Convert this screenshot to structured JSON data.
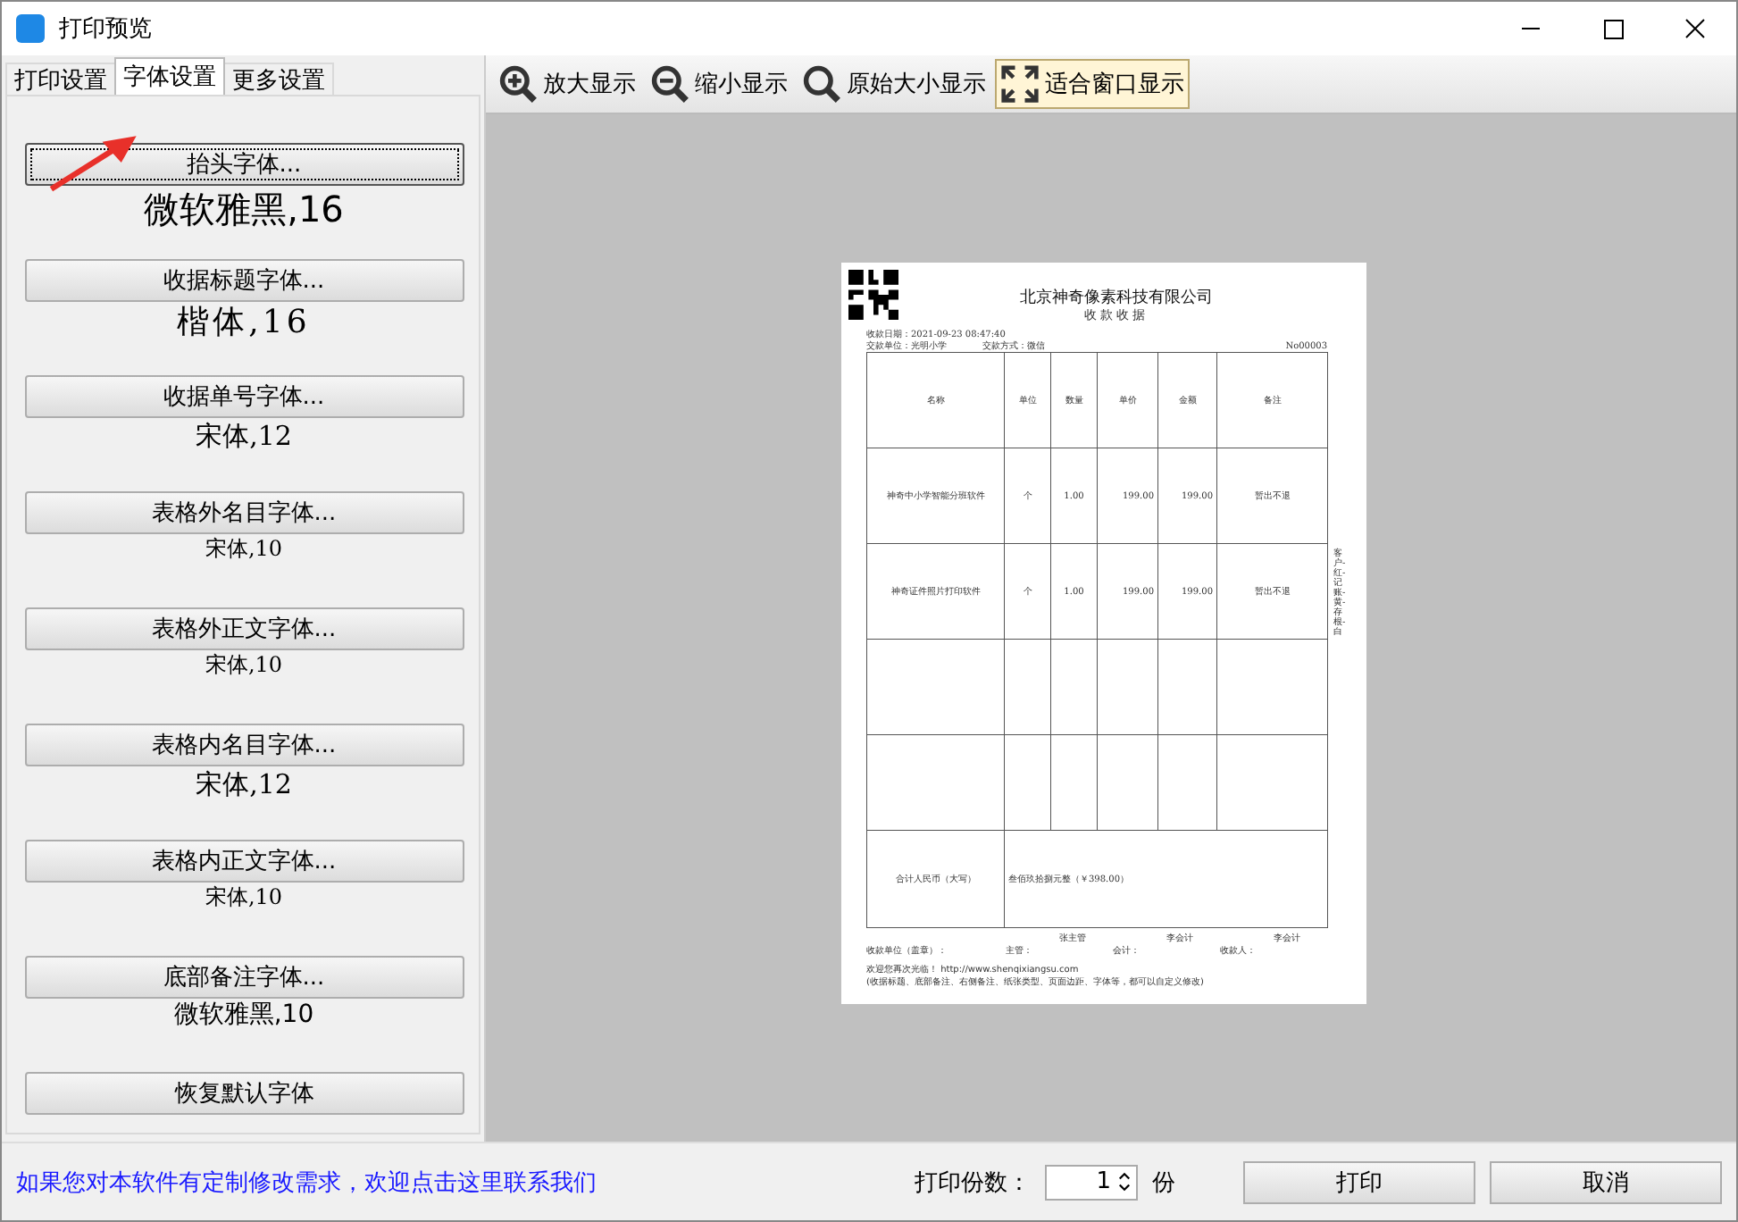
{
  "window": {
    "title": "打印预览"
  },
  "tabs": [
    {
      "label": "打印设置",
      "selected": false
    },
    {
      "label": "字体设置",
      "selected": true
    },
    {
      "label": "更多设置",
      "selected": false
    }
  ],
  "font_settings": [
    {
      "button": "抬头字体...",
      "sample": "微软雅黑,16",
      "kind": "yahei-large",
      "focused": true
    },
    {
      "button": "收据标题字体...",
      "sample": "楷体,16",
      "kind": "kai-large",
      "focused": false
    },
    {
      "button": "收据单号字体...",
      "sample": "宋体,12",
      "kind": "song-medium",
      "focused": false
    },
    {
      "button": "表格外名目字体...",
      "sample": "宋体,10",
      "kind": "song-small",
      "focused": false
    },
    {
      "button": "表格外正文字体...",
      "sample": "宋体,10",
      "kind": "song-small",
      "focused": false
    },
    {
      "button": "表格内名目字体...",
      "sample": "宋体,12",
      "kind": "song-medium",
      "focused": false
    },
    {
      "button": "表格内正文字体...",
      "sample": "宋体,10",
      "kind": "song-small",
      "focused": false
    },
    {
      "button": "底部备注字体...",
      "sample": "微软雅黑,10",
      "kind": "yahei-small",
      "focused": false
    }
  ],
  "restore_button": "恢复默认字体",
  "toolbar": [
    {
      "label": "放大显示",
      "kind": "zoom-in",
      "selected": false
    },
    {
      "label": "缩小显示",
      "kind": "zoom-out",
      "selected": false
    },
    {
      "label": "原始大小显示",
      "kind": "actual",
      "selected": false
    },
    {
      "label": "适合窗口显示",
      "kind": "fit",
      "selected": true
    }
  ],
  "receipt": {
    "company": "北京神奇像素科技有限公司",
    "title": "收款收据",
    "date": "收款日期：2021-09-23 08:47:40",
    "payer": "交款单位：光明小学",
    "method": "交款方式：微信",
    "number": "No00003",
    "columns": [
      "名称",
      "单位",
      "数量",
      "单价",
      "金额",
      "备注"
    ],
    "rows": [
      [
        "神奇中小学智能分班软件",
        "个",
        "1.00",
        "199.00",
        "199.00",
        "暂出不退"
      ],
      [
        "神奇证件照片打印软件",
        "个",
        "1.00",
        "199.00",
        "199.00",
        "暂出不退"
      ],
      [
        "",
        "",
        "",
        "",
        "",
        ""
      ],
      [
        "",
        "",
        "",
        "",
        "",
        ""
      ]
    ],
    "total_label": "合计人民币（大写）",
    "total_value": "叁佰玖拾捌元整（￥398.00）",
    "side_note": "客户-红-记账-黄-存根-白",
    "signatures": [
      {
        "label": "收款单位（盖章）："
      },
      {
        "label": "主管：",
        "name": "张主管"
      },
      {
        "label": "会计：",
        "name": "李会计"
      },
      {
        "label": "收款人：",
        "name": "李会计"
      }
    ],
    "footer": [
      "欢迎您再次光临！ http://www.shenqixiangsu.com",
      "(收据标题、底部备注、右侧备注、纸张类型、页面边距、字体等，都可以自定义修改)"
    ]
  },
  "bottom": {
    "link": "如果您对本软件有定制修改需求，欢迎点击这里联系我们",
    "copies_label": "打印份数：",
    "copies": "1",
    "copies_unit": "份",
    "print": "打印",
    "cancel": "取消"
  }
}
